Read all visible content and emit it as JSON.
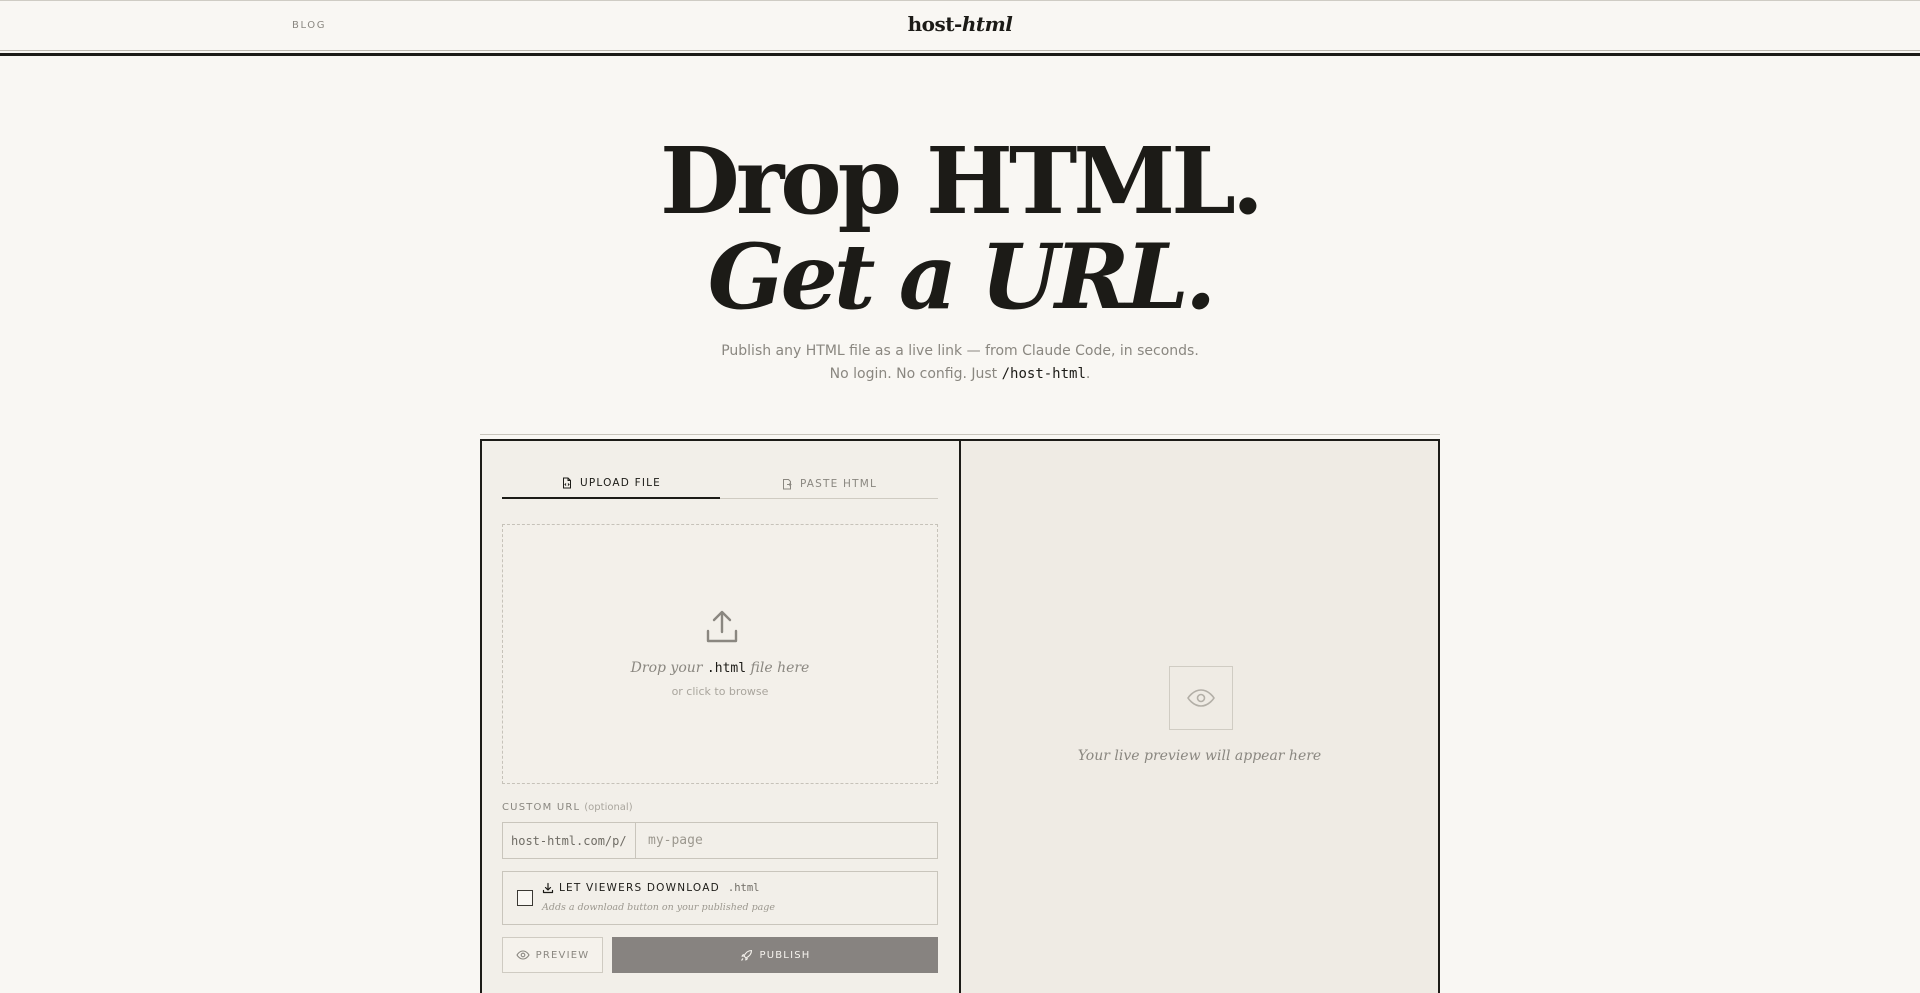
{
  "nav": {
    "blog": "BLOG",
    "logo_main": "host-",
    "logo_em": "html"
  },
  "hero": {
    "line1": "Drop HTML.",
    "line2": "Get a URL.",
    "sub1": "Publish any HTML file as a live link — from Claude Code, in seconds.",
    "sub2_pre": "No login. No config. Just ",
    "sub2_code": "/host-html",
    "sub2_post": "."
  },
  "tabs": [
    {
      "label": "UPLOAD FILE",
      "active": true
    },
    {
      "label": "PASTE HTML",
      "active": false
    }
  ],
  "dropzone": {
    "text_pre": "Drop your ",
    "text_code": ".html",
    "text_post": " file here",
    "sub": "or click to browse"
  },
  "custom_url": {
    "label": "CUSTOM URL",
    "optional": "(optional)",
    "prefix": "host-html.com/p/",
    "placeholder": "my-page",
    "value": ""
  },
  "download": {
    "title": "LET VIEWERS DOWNLOAD",
    "ext": ".html",
    "sub": "Adds a download button on your published page",
    "checked": false
  },
  "actions": {
    "preview": "PREVIEW",
    "publish": "PUBLISH"
  },
  "preview_panel": {
    "placeholder": "Your live preview will appear here"
  },
  "colors": {
    "background": "#f9f7f3",
    "ink": "#1c1b17",
    "muted": "#8a8780",
    "publish_button": "#878380",
    "panel_bg": "#efebe4"
  }
}
